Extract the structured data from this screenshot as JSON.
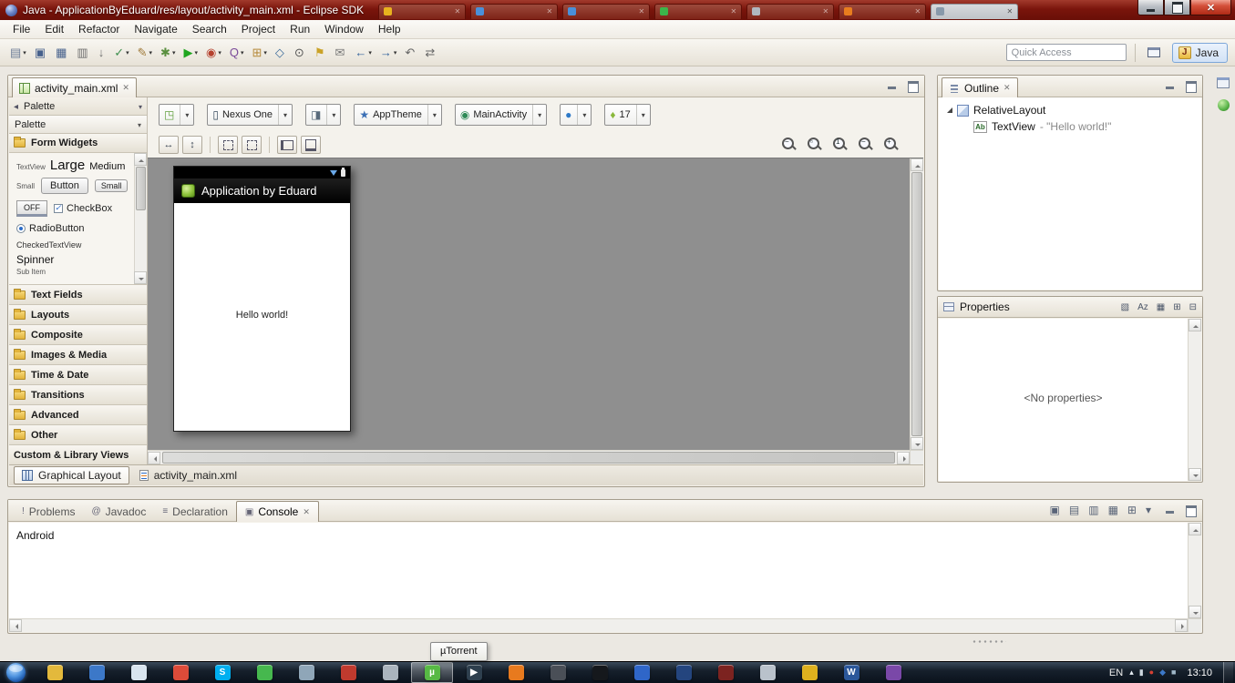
{
  "titlebar": {
    "title": "Java - ApplicationByEduard/res/layout/activity_main.xml - Eclipse SDK",
    "tabs": [
      {
        "label": "",
        "fav": "#e8b21e"
      },
      {
        "label": "",
        "fav": "#4a90d9"
      },
      {
        "label": "",
        "fav": "#4a90d9"
      },
      {
        "label": "",
        "fav": "#3cb54a"
      },
      {
        "label": "",
        "fav": "#b0b7bf"
      },
      {
        "label": "",
        "fav": "#e87d1e"
      },
      {
        "label": "",
        "fav": "#8899aa",
        "active": true
      }
    ]
  },
  "menu": {
    "items": [
      "File",
      "Edit",
      "Refactor",
      "Navigate",
      "Search",
      "Project",
      "Run",
      "Window",
      "Help"
    ]
  },
  "toolbar": {
    "icons": [
      {
        "name": "new",
        "glyph": "▤",
        "color": "#6b7b96",
        "arrow": "▾"
      },
      {
        "name": "save",
        "glyph": "▣",
        "color": "#46608c",
        "arrow": ""
      },
      {
        "name": "save-all",
        "glyph": "▦",
        "color": "#46608c",
        "arrow": ""
      },
      {
        "name": "print",
        "glyph": "▥",
        "color": "#6f6f6f",
        "arrow": ""
      },
      {
        "name": "export",
        "glyph": "↓",
        "color": "#6f6f6f",
        "arrow": ""
      },
      {
        "name": "build",
        "glyph": "✓",
        "color": "#3f8f4f",
        "arrow": "▾"
      },
      {
        "name": "wizard",
        "glyph": "✎",
        "color": "#a07a3a",
        "arrow": "▾"
      },
      {
        "name": "debug",
        "glyph": "✱",
        "color": "#5a8f3f",
        "arrow": "▾"
      },
      {
        "name": "run",
        "glyph": "▶",
        "color": "#1fa51f",
        "arrow": "▾"
      },
      {
        "name": "profile",
        "glyph": "◉",
        "color": "#b5412e",
        "arrow": "▾"
      },
      {
        "name": "coverage",
        "glyph": "Q",
        "color": "#7a4a9a",
        "arrow": "▾"
      },
      {
        "name": "new-java-element",
        "glyph": "⊞",
        "color": "#b5893a",
        "arrow": "▾"
      },
      {
        "name": "open-type",
        "glyph": "◇",
        "color": "#3a6a9a",
        "arrow": ""
      },
      {
        "name": "search",
        "glyph": "⊙",
        "color": "#555555",
        "arrow": ""
      },
      {
        "name": "mark-occurrences",
        "glyph": "⚑",
        "color": "#caa227",
        "arrow": ""
      },
      {
        "name": "annotations",
        "glyph": "✉",
        "color": "#777777",
        "arrow": ""
      },
      {
        "name": "back",
        "glyph": "←",
        "color": "#33629c",
        "arrow": "▾"
      },
      {
        "name": "forward",
        "glyph": "→",
        "color": "#33629c",
        "arrow": "▾"
      },
      {
        "name": "last-edit",
        "glyph": "↶",
        "color": "#666666",
        "arrow": ""
      },
      {
        "name": "link-editor",
        "glyph": "⇄",
        "color": "#666666",
        "arrow": ""
      }
    ],
    "quick_access_placeholder": "Quick Access",
    "perspective_icon": "J",
    "perspective_label": "Java"
  },
  "editor": {
    "tab": "activity_main.xml",
    "palette": {
      "header": "Palette",
      "combo": "Palette",
      "form_widgets": {
        "title": "Form Widgets",
        "textview_small": "TextView",
        "large": "Large",
        "medium": "Medium",
        "small_label": "Small",
        "button": "Button",
        "small_button": "Small",
        "toggle": "OFF",
        "checkbox": "CheckBox",
        "radio": "RadioButton",
        "checked_textview": "CheckedTextView",
        "spinner": "Spinner",
        "sub_item": "Sub Item"
      },
      "categories": [
        "Text Fields",
        "Layouts",
        "Composite",
        "Images & Media",
        "Time & Date",
        "Transitions",
        "Advanced",
        "Other"
      ],
      "custom_views": "Custom & Library Views"
    },
    "config": {
      "combos": [
        {
          "glyph": "◳",
          "color": "#5f9e3c",
          "label": ""
        },
        {
          "glyph": "▯",
          "color": "#33475a",
          "label": "Nexus One"
        },
        {
          "glyph": "◨",
          "color": "#5a6b7c",
          "label": ""
        },
        {
          "glyph": "★",
          "color": "#3b6fb5",
          "label": "AppTheme"
        },
        {
          "glyph": "◉",
          "color": "#2e8b57",
          "label": "MainActiv­ity"
        },
        {
          "glyph": "●",
          "color": "#2e7ac8",
          "label": ""
        },
        {
          "glyph": "♦",
          "color": "#8ab83c",
          "label": "17"
        }
      ]
    },
    "canvas": {
      "app_title": "Application by Eduard",
      "hello": "Hello world!"
    },
    "bottom_tabs": [
      {
        "label": "Graphical Layout",
        "active": true
      },
      {
        "label": "activity_main.xml",
        "active": false
      }
    ]
  },
  "outline": {
    "title": "Outline",
    "root": "RelativeLayout",
    "child_icon": "Ab",
    "child_type": "TextView",
    "child_value": "- \"Hello world!\""
  },
  "properties": {
    "title": "Properties",
    "toolbar": [
      "▧",
      "Az",
      "▦",
      "⊞",
      "⊟"
    ],
    "empty": "<No properties>"
  },
  "console": {
    "tabs": [
      {
        "icon": "!",
        "label": "Problems",
        "active": false
      },
      {
        "icon": "@",
        "label": "Javadoc",
        "active": false
      },
      {
        "icon": "≡",
        "label": "Declaration",
        "active": false
      },
      {
        "icon": "▣",
        "label": "Console",
        "active": true
      }
    ],
    "toolbar": [
      "▣",
      "▤",
      "▥",
      "▦",
      "⊞",
      "▾"
    ],
    "first_line": "Android"
  },
  "tooltip": {
    "text": "µTorrent"
  },
  "taskbar": {
    "icons": [
      {
        "name": "explorer",
        "color": "#e3b93c",
        "glyph": ""
      },
      {
        "name": "firefox",
        "color": "#3c78c8",
        "glyph": ""
      },
      {
        "name": "notepad",
        "color": "#d8e4ee",
        "glyph": ""
      },
      {
        "name": "chrome",
        "color": "#dd4b39",
        "glyph": ""
      },
      {
        "name": "skype",
        "color": "#00aff0",
        "glyph": "S"
      },
      {
        "name": "app-green",
        "color": "#46b84e",
        "glyph": ""
      },
      {
        "name": "app-steel",
        "color": "#8fa6b8",
        "glyph": ""
      },
      {
        "name": "app-red",
        "color": "#c03a2e",
        "glyph": ""
      },
      {
        "name": "app-gray",
        "color": "#aab4bd",
        "glyph": ""
      },
      {
        "name": "utorrent",
        "color": "#57b944",
        "glyph": "µ",
        "active": true
      },
      {
        "name": "media-player",
        "color": "#2e3f4e",
        "glyph": "▶"
      },
      {
        "name": "app-orange",
        "color": "#e87a1e",
        "glyph": ""
      },
      {
        "name": "app-dark",
        "color": "#4a4f57",
        "glyph": ""
      },
      {
        "name": "command-prompt",
        "color": "#15181c",
        "glyph": ""
      },
      {
        "name": "app-blue",
        "color": "#2f66c8",
        "glyph": ""
      },
      {
        "name": "app-navy",
        "color": "#24457e",
        "glyph": ""
      },
      {
        "name": "app-maroon",
        "color": "#7c2320",
        "glyph": ""
      },
      {
        "name": "app-silver",
        "color": "#b9c2cb",
        "glyph": ""
      },
      {
        "name": "app-amber",
        "color": "#deb11e",
        "glyph": ""
      },
      {
        "name": "word",
        "color": "#2b579a",
        "glyph": "W"
      },
      {
        "name": "app-purple",
        "color": "#7a48a8",
        "glyph": ""
      }
    ],
    "tray": {
      "lang": "EN",
      "icons": [
        {
          "glyph": "▴",
          "color": "#e8eef4"
        },
        {
          "glyph": "▮",
          "color": "#cdd6de"
        },
        {
          "glyph": "●",
          "color": "#d64033"
        },
        {
          "glyph": "◆",
          "color": "#3c78c8"
        },
        {
          "glyph": "■",
          "color": "#9fb6c7"
        }
      ],
      "time": "13:10"
    }
  }
}
